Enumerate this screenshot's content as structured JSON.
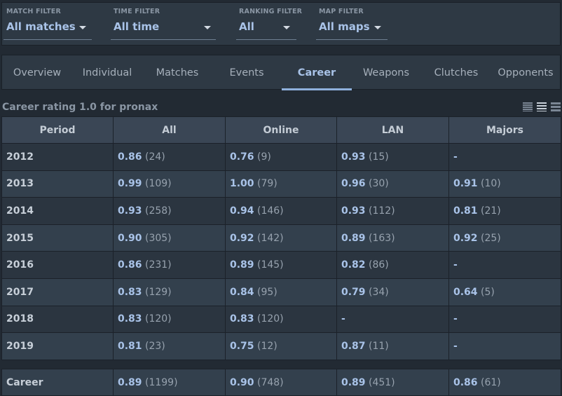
{
  "filters": [
    {
      "label": "MATCH FILTER",
      "value": "All matches"
    },
    {
      "label": "TIME FILTER",
      "value": "All time"
    },
    {
      "label": "RANKING FILTER",
      "value": "All"
    },
    {
      "label": "MAP FILTER",
      "value": "All maps"
    }
  ],
  "tabs": [
    {
      "label": "Overview",
      "active": false
    },
    {
      "label": "Individual",
      "active": false
    },
    {
      "label": "Matches",
      "active": false
    },
    {
      "label": "Events",
      "active": false
    },
    {
      "label": "Career",
      "active": true
    },
    {
      "label": "Weapons",
      "active": false
    },
    {
      "label": "Clutches",
      "active": false
    },
    {
      "label": "Opponents",
      "active": false
    }
  ],
  "table": {
    "title": "Career rating 1.0 for pronax",
    "view_icons": [
      "compact-list-icon",
      "list-icon",
      "wide-list-icon"
    ],
    "columns": [
      "Period",
      "All",
      "Online",
      "LAN",
      "Majors"
    ],
    "rows": [
      {
        "period": "2012",
        "all": {
          "rating": "0.86",
          "count": "(24)"
        },
        "online": {
          "rating": "0.76",
          "count": "(9)"
        },
        "lan": {
          "rating": "0.93",
          "count": "(15)"
        },
        "majors": {
          "rating": "-",
          "count": ""
        }
      },
      {
        "period": "2013",
        "all": {
          "rating": "0.99",
          "count": "(109)"
        },
        "online": {
          "rating": "1.00",
          "count": "(79)"
        },
        "lan": {
          "rating": "0.96",
          "count": "(30)"
        },
        "majors": {
          "rating": "0.91",
          "count": "(10)"
        }
      },
      {
        "period": "2014",
        "all": {
          "rating": "0.93",
          "count": "(258)"
        },
        "online": {
          "rating": "0.94",
          "count": "(146)"
        },
        "lan": {
          "rating": "0.93",
          "count": "(112)"
        },
        "majors": {
          "rating": "0.81",
          "count": "(21)"
        }
      },
      {
        "period": "2015",
        "all": {
          "rating": "0.90",
          "count": "(305)"
        },
        "online": {
          "rating": "0.92",
          "count": "(142)"
        },
        "lan": {
          "rating": "0.89",
          "count": "(163)"
        },
        "majors": {
          "rating": "0.92",
          "count": "(25)"
        }
      },
      {
        "period": "2016",
        "all": {
          "rating": "0.86",
          "count": "(231)"
        },
        "online": {
          "rating": "0.89",
          "count": "(145)"
        },
        "lan": {
          "rating": "0.82",
          "count": "(86)"
        },
        "majors": {
          "rating": "-",
          "count": ""
        }
      },
      {
        "period": "2017",
        "all": {
          "rating": "0.83",
          "count": "(129)"
        },
        "online": {
          "rating": "0.84",
          "count": "(95)"
        },
        "lan": {
          "rating": "0.79",
          "count": "(34)"
        },
        "majors": {
          "rating": "0.64",
          "count": "(5)"
        }
      },
      {
        "period": "2018",
        "all": {
          "rating": "0.83",
          "count": "(120)"
        },
        "online": {
          "rating": "0.83",
          "count": "(120)"
        },
        "lan": {
          "rating": "-",
          "count": ""
        },
        "majors": {
          "rating": "-",
          "count": ""
        }
      },
      {
        "period": "2019",
        "all": {
          "rating": "0.81",
          "count": "(23)"
        },
        "online": {
          "rating": "0.75",
          "count": "(12)"
        },
        "lan": {
          "rating": "0.87",
          "count": "(11)"
        },
        "majors": {
          "rating": "-",
          "count": ""
        }
      }
    ],
    "career": {
      "period": "Career",
      "all": {
        "rating": "0.89",
        "count": "(1199)"
      },
      "online": {
        "rating": "0.90",
        "count": "(748)"
      },
      "lan": {
        "rating": "0.89",
        "count": "(451)"
      },
      "majors": {
        "rating": "0.86",
        "count": "(61)"
      }
    }
  },
  "colors": {
    "accent": "#a9c3e8",
    "background": "#222a33",
    "panel": "#2e3944"
  }
}
